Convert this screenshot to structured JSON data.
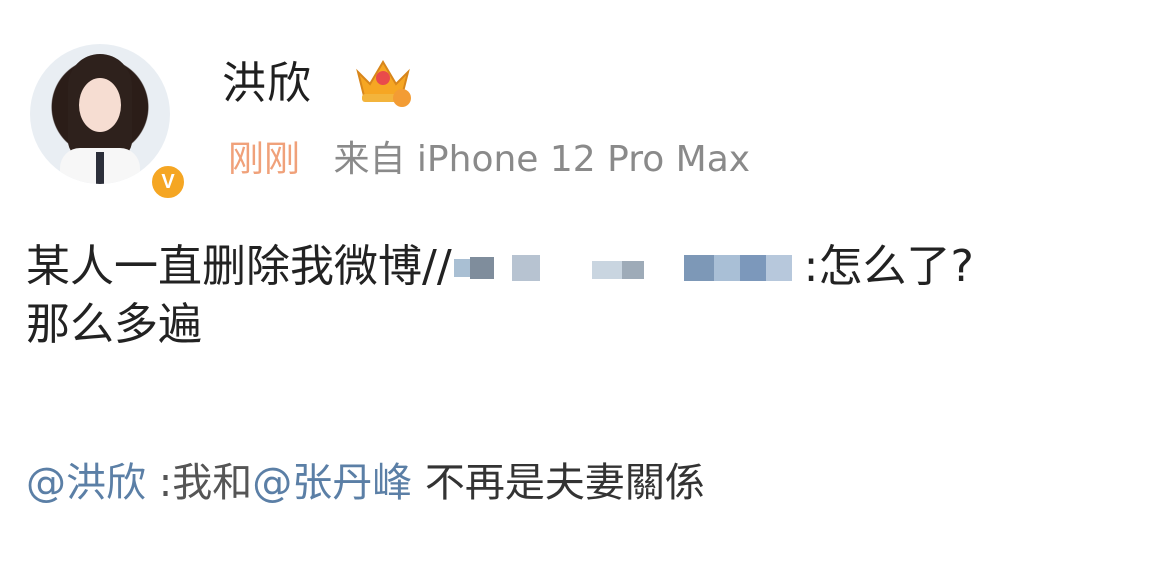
{
  "author": {
    "name": "洪欣",
    "verified_badge": "V"
  },
  "icons": {
    "avatar": "profile-photo",
    "verified": "verified-v-icon",
    "crown": "crown-icon"
  },
  "colors": {
    "link": "#5b7fa6",
    "time": "#f0a17a",
    "source": "#8a8a8a",
    "badge": "#f5a623"
  },
  "meta": {
    "time": "刚刚",
    "source": "来自 iPhone 12 Pro Max"
  },
  "post": {
    "text_before": "某人一直删除我微博//",
    "text_after": ":怎么了?",
    "text_line2": "那么多遍"
  },
  "repost": {
    "mention_1": "@洪欣",
    "text_1": " :我和",
    "mention_2": "@张丹峰",
    "text_2": " 不再是夫妻關係"
  }
}
